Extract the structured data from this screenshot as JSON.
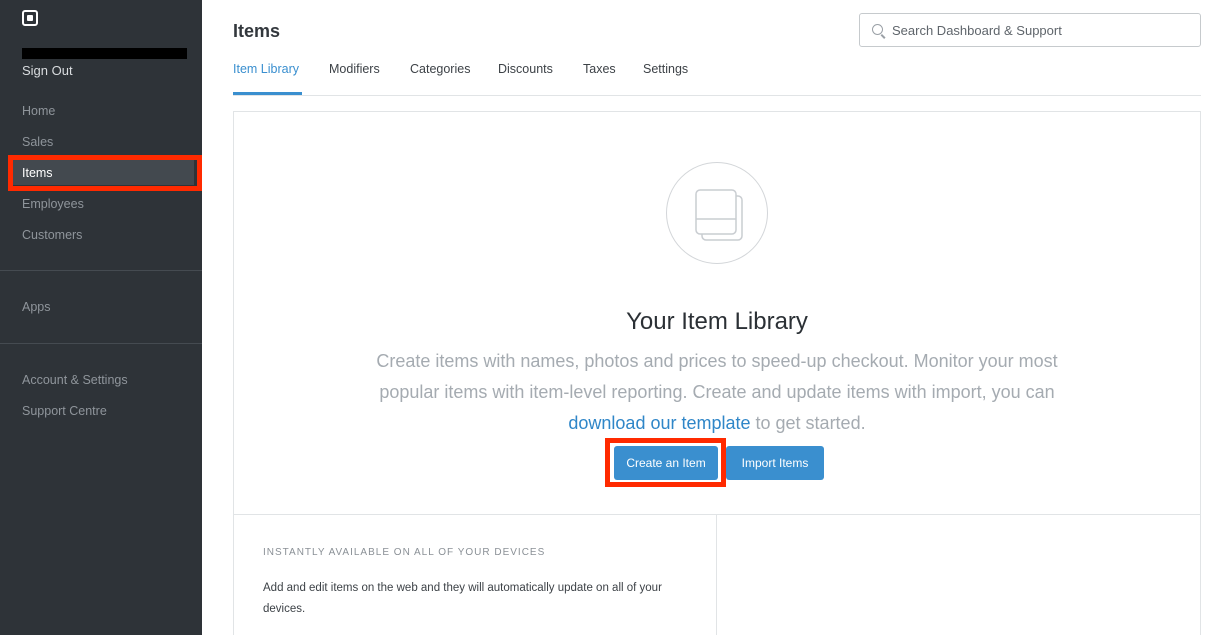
{
  "sidebar": {
    "sign_out": "Sign Out",
    "nav": [
      {
        "label": "Home"
      },
      {
        "label": "Sales"
      },
      {
        "label": "Items"
      },
      {
        "label": "Employees"
      },
      {
        "label": "Customers"
      }
    ],
    "apps": "Apps",
    "bottom": [
      {
        "label": "Account & Settings"
      },
      {
        "label": "Support Centre"
      }
    ]
  },
  "header": {
    "title": "Items",
    "search_placeholder": "Search Dashboard & Support"
  },
  "tabs": [
    {
      "label": "Item Library",
      "active": true
    },
    {
      "label": "Modifiers"
    },
    {
      "label": "Categories"
    },
    {
      "label": "Discounts"
    },
    {
      "label": "Taxes"
    },
    {
      "label": "Settings"
    }
  ],
  "library": {
    "icon": "item-library-icon",
    "title": "Your Item Library",
    "desc_before": "Create items with names, photos and prices to speed-up checkout. Monitor your most popular items with item-level reporting. Create and update items with import, you can ",
    "desc_link": "download our template",
    "desc_after": " to get started.",
    "create_button": "Create an Item",
    "import_button": "Import Items"
  },
  "feature": {
    "eyebrow": "INSTANTLY AVAILABLE ON ALL OF YOUR DEVICES",
    "text": "Add and edit items on the web and they will automatically update on all of your devices."
  },
  "colors": {
    "sidebar_bg": "#2e3338",
    "accent": "#3a8fcf",
    "highlight": "#ff2a00"
  }
}
